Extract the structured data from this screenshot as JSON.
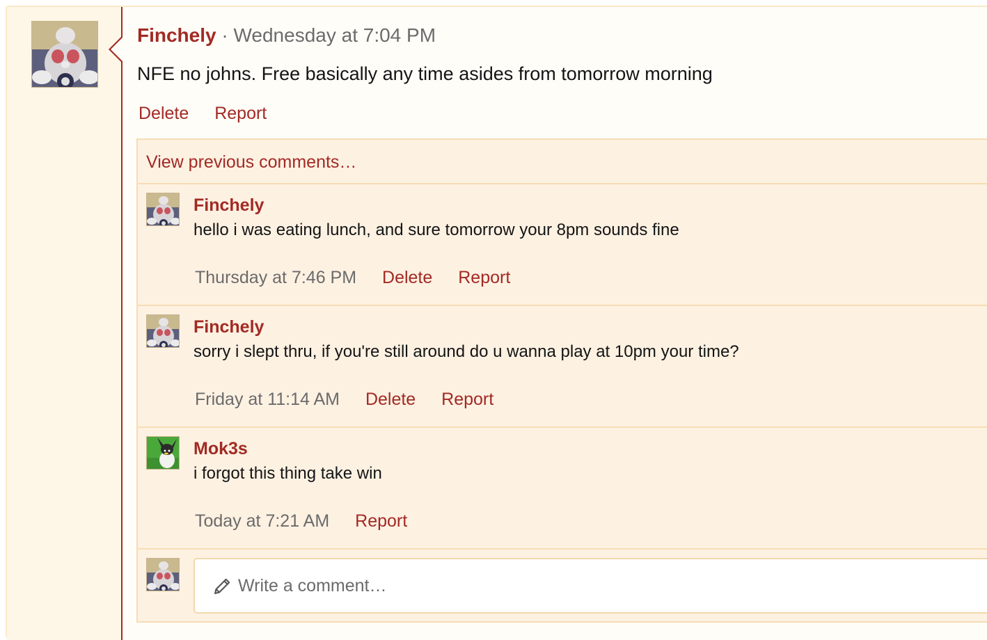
{
  "post": {
    "author": "Finchely",
    "separator": "·",
    "timestamp": "Wednesday at 7:04 PM",
    "body": "NFE no johns. Free basically any time asides from tomorrow morning",
    "actions": {
      "delete": "Delete",
      "report": "Report"
    }
  },
  "comments_panel": {
    "view_previous": "View previous comments…",
    "items": [
      {
        "author": "Finchely",
        "text": "hello i was eating lunch, and sure tomorrow your 8pm sounds fine",
        "time": "Thursday at 7:46 PM",
        "delete": "Delete",
        "report": "Report"
      },
      {
        "author": "Finchely",
        "text": "sorry i slept thru, if you're still around do u wanna play at 10pm your time?",
        "time": "Friday at 11:14 AM",
        "delete": "Delete",
        "report": "Report"
      },
      {
        "author": "Mok3s",
        "text": "i forgot this thing take win",
        "time": "Today at 7:21 AM",
        "report": "Report"
      }
    ]
  },
  "reply": {
    "placeholder": "Write a comment…",
    "icon": "pencil-icon"
  },
  "colors": {
    "accent": "#a22a24",
    "background": "#fef6e7",
    "comment_bg": "#fdf1e2",
    "border": "#f6dcb4",
    "muted_text": "#6b6b6b"
  }
}
